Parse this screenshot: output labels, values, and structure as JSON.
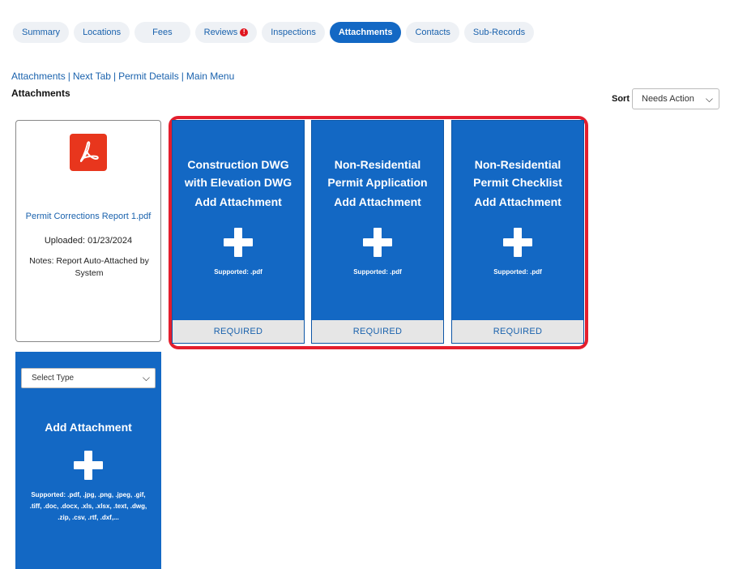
{
  "tabs": [
    {
      "label": "Summary",
      "active": false
    },
    {
      "label": "Locations",
      "active": false
    },
    {
      "label": "Fees",
      "active": false
    },
    {
      "label": "Reviews",
      "active": false,
      "badge": "!"
    },
    {
      "label": "Inspections",
      "active": false
    },
    {
      "label": "Attachments",
      "active": true
    },
    {
      "label": "Contacts",
      "active": false
    },
    {
      "label": "Sub-Records",
      "active": false
    }
  ],
  "breadcrumb": {
    "items": [
      "Attachments",
      "Next Tab",
      "Permit Details",
      "Main Menu"
    ],
    "separator": "|"
  },
  "section_title": "Attachments",
  "sort": {
    "label": "Sort",
    "value": "Needs Action"
  },
  "uploaded_file": {
    "icon": "pdf-file-icon",
    "file_name": "Permit Corrections Report 1.pdf",
    "uploaded": "Uploaded: 01/23/2024",
    "notes": "Notes: Report Auto-Attached by System"
  },
  "required_cards": [
    {
      "title_line1": "Construction DWG",
      "title_line2": "with Elevation DWG",
      "add_label": "Add Attachment",
      "supported": "Supported: .pdf",
      "status": "REQUIRED"
    },
    {
      "title_line1": "Non-Residential",
      "title_line2": "Permit Application",
      "add_label": "Add Attachment",
      "supported": "Supported: .pdf",
      "status": "REQUIRED"
    },
    {
      "title_line1": "Non-Residential",
      "title_line2": "Permit Checklist",
      "add_label": "Add Attachment",
      "supported": "Supported: .pdf",
      "status": "REQUIRED"
    }
  ],
  "generic_card": {
    "type_select": "Select Type",
    "add_label": "Add Attachment",
    "supported": "Supported: .pdf, .jpg, .png, .jpeg, .gif, .tiff, .doc, .docx, .xls, .xlsx, .text, .dwg, .zip, .csv, .rtf, .dxf,..."
  },
  "colors": {
    "primary": "#1368c4",
    "highlight": "#e41e2d",
    "link": "#1a62ad",
    "pdf": "#e8361d"
  }
}
